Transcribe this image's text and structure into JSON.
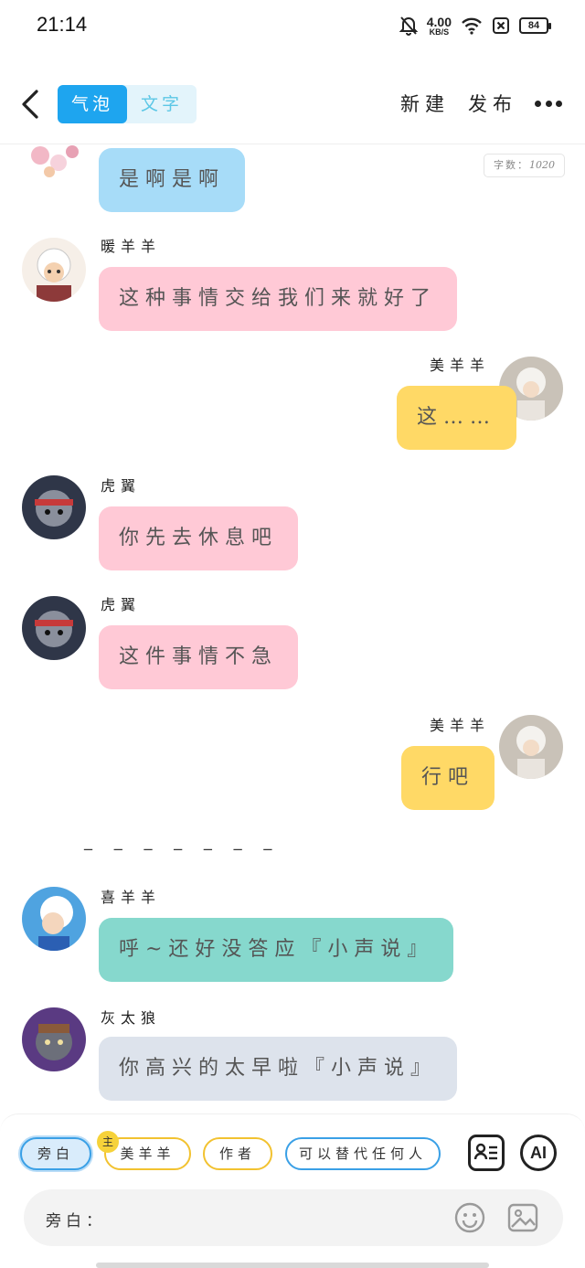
{
  "status_bar": {
    "time": "21:14",
    "net_speed": "4.00",
    "net_unit": "KB/S",
    "battery": "84",
    "icons": [
      "bell-off-icon",
      "wifi-icon",
      "sim-off-icon",
      "battery-icon"
    ]
  },
  "header": {
    "tabs": [
      {
        "label": "气泡",
        "active": true
      },
      {
        "label": "文字",
        "active": false
      }
    ],
    "new_label": "新建",
    "publish_label": "发布"
  },
  "word_count": {
    "label": "字数：",
    "value": "1020"
  },
  "messages": [
    {
      "name": "",
      "text": "是啊是啊",
      "color": "#a7dcf8",
      "side": "left"
    },
    {
      "name": "暖羊羊",
      "text": "这种事情交给我们来就好了",
      "color": "#ffc9d6",
      "side": "left"
    },
    {
      "name": "美羊羊",
      "text": "这……",
      "color": "#ffd966",
      "side": "right"
    },
    {
      "name": "虎翼",
      "text": "你先去休息吧",
      "color": "#ffc9d6",
      "side": "left"
    },
    {
      "name": "虎翼",
      "text": "这件事情不急",
      "color": "#ffc9d6",
      "side": "left"
    },
    {
      "name": "美羊羊",
      "text": "行吧",
      "color": "#ffd966",
      "side": "right"
    },
    {
      "name": "喜羊羊",
      "text": "呼~还好没答应『小声说』",
      "color": "#86d8cd",
      "side": "left"
    },
    {
      "name": "灰太狼",
      "text": "你高兴的太早啦『小声说』",
      "color": "#dde3ec",
      "side": "left"
    }
  ],
  "divider": "_ _ _ _ _ _ _",
  "roles": [
    {
      "label": "旁白",
      "selected": true
    },
    {
      "label": "美羊羊",
      "badge": "主"
    },
    {
      "label": "作者"
    },
    {
      "label": "可以替代任何人"
    }
  ],
  "ai_label": "AI",
  "input": {
    "label": "旁白："
  }
}
